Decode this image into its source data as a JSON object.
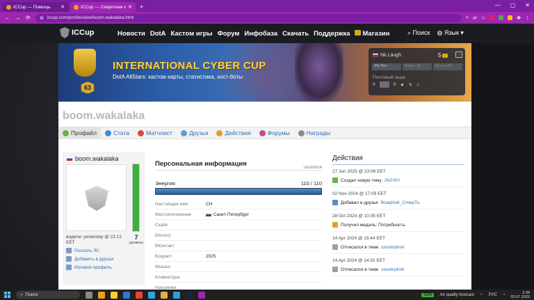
{
  "browser": {
    "tabs": [
      {
        "title": "ICCup — Помощь",
        "active": false
      },
      {
        "title": "ICCup — Секретная информ.",
        "active": true
      }
    ],
    "new_tab": "+",
    "window_controls": [
      "—",
      "▢",
      "✕"
    ],
    "url": "iccup.com/profile/view/boom.wakalaka.html"
  },
  "site": {
    "logo": "ICCup",
    "menu": [
      "Новости",
      "DotA",
      "Кастом игры",
      "Форум",
      "Инфобаза",
      "Скачать",
      "Поддержка",
      "Магазин"
    ],
    "search": "Поиск",
    "language": "Язык ▾"
  },
  "banner": {
    "title": "INTERNATIONAL CYBER CUP",
    "subtitle": "DotA AllStars: кастом карты, статистика, хост-боты",
    "level": "63"
  },
  "userbox": {
    "name": "Nk.Laugh",
    "coins": "5",
    "stats": [
      "3% Pro",
      "Armor off",
      "Bonus off"
    ],
    "mailbox_label": "Почтовый ящик",
    "mail_count": "0",
    "alert_count": "0"
  },
  "profile": {
    "username": "boom.wakalaka",
    "tabs": [
      "Профайл",
      "Стата",
      "Матчлист",
      "Друзья",
      "Действия",
      "Форумы",
      "Награды"
    ],
    "active_tab": "Профайл",
    "card": {
      "name": "boom.wakalaka",
      "level_num": "7",
      "level_label": "уровень",
      "last_seen": "видели: yesterday @ 22:12 EET",
      "links": [
        "Послать ЛС",
        "Добавить в друзья",
        "Игровой профиль"
      ]
    },
    "info": {
      "title": "Персональная информация",
      "legend": "LEGENDA",
      "energy_label": "Энергия",
      "energy_value": "110 / 110",
      "energy_fraction": 1.0,
      "rows": [
        {
          "key": "Настоящее имя",
          "value": "CH"
        },
        {
          "key": "Местоположение",
          "value": "Санкт-Петербург"
        },
        {
          "key": "Скайп",
          "value": ""
        },
        {
          "key": "Discord",
          "value": ""
        },
        {
          "key": "ВКонтакт",
          "value": ""
        },
        {
          "key": "Возраст",
          "value": "2025"
        },
        {
          "key": "Мышка",
          "value": ""
        },
        {
          "key": "Клавиатура",
          "value": ""
        },
        {
          "key": "Наушники",
          "value": ""
        }
      ]
    },
    "actions": {
      "title": "Действия",
      "items": [
        {
          "date": "27 Jun 2025 @ 23:08 EET",
          "text": "Создал новую тему",
          "link": "ЛАГИ!!!",
          "color": "#6ab04c"
        },
        {
          "date": "02 Nov 2024 @ 17:09 EET",
          "text": "Добавил в друзья",
          "link": "BcaqHuK_CmepTu",
          "color": "#5b8cc8"
        },
        {
          "date": "28 Oct 2024 @ 10:35 EET",
          "text": "Получил медаль: Потребность",
          "link": "",
          "color": "#d9a520"
        },
        {
          "date": "14 Apr 2024 @ 15:44 EET",
          "text": "Отписался в теме",
          "link": "countrylimit",
          "color": "#9aa0a8"
        },
        {
          "date": "14 Apr 2024 @ 14:32 EET",
          "text": "Отписался в теме",
          "link": "countrylimit",
          "color": "#9aa0a8"
        }
      ]
    }
  },
  "taskbar": {
    "search": "Поиск",
    "battery": "53%",
    "weather": "Air quality forecast",
    "lang": "РУС",
    "time": "2:34",
    "date": "02.07.2025"
  }
}
